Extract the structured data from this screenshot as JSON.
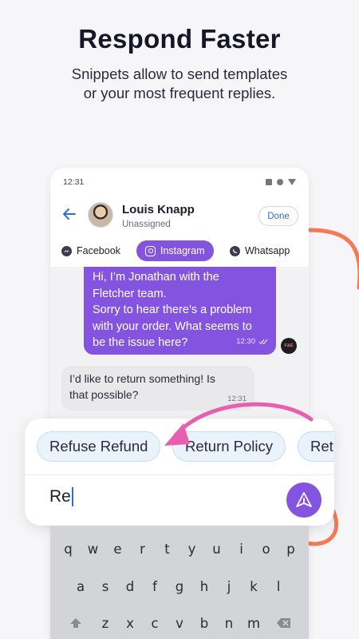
{
  "headline": "Respond Faster",
  "subline": [
    "Snippets allow to send templates",
    "or your most frequent replies."
  ],
  "phone": {
    "status_time": "12:31",
    "contact": {
      "name": "Louis Knapp",
      "status": "Unassigned"
    },
    "done_label": "Done",
    "tabs": [
      {
        "label": "Facebook",
        "icon": "messenger-icon",
        "active": false
      },
      {
        "label": "Instagram",
        "icon": "instagram-icon",
        "active": true
      },
      {
        "label": "Whatsapp",
        "icon": "whatsapp-icon",
        "active": false
      }
    ],
    "messages": {
      "outgoing": {
        "lines": [
          "Hi, I’m Jonathan with the",
          "Fletcher team.",
          "Sorry to hear there’s a problem",
          "with your order. What seems to",
          "be the issue here?"
        ],
        "time": "12:30",
        "agent_badge": "F&E"
      },
      "incoming": {
        "lines": [
          "I’d like to return something! Is",
          "that possible?"
        ],
        "time": "12:31"
      }
    }
  },
  "composer": {
    "snippets": [
      "Refuse Refund",
      "Return Policy",
      "Retu"
    ],
    "input_value": "Re"
  },
  "keyboard": {
    "row1": [
      "q",
      "w",
      "e",
      "r",
      "t",
      "y",
      "u",
      "i",
      "o",
      "p"
    ],
    "row2": [
      "a",
      "s",
      "d",
      "f",
      "g",
      "h",
      "j",
      "k",
      "l"
    ],
    "row3": [
      "z",
      "x",
      "c",
      "v",
      "b",
      "n",
      "m"
    ]
  },
  "colors": {
    "accent": "#8454e0",
    "chip_bg": "#eaf3fb",
    "link": "#2e6fd0",
    "arrow_orange": "#f47a56",
    "arrow_pink": "#e85fb0"
  }
}
